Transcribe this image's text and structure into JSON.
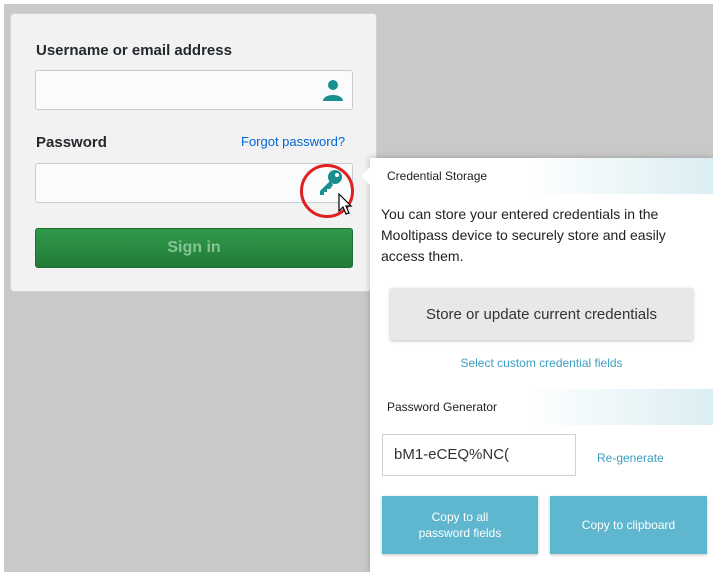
{
  "login": {
    "username_label": "Username or email address",
    "password_label": "Password",
    "forgot_link": "Forgot password?",
    "username_value": "",
    "password_value": "",
    "signin_label": "Sign in",
    "user_icon": "user-icon",
    "key_icon": "key-icon"
  },
  "popup": {
    "credential_storage_title": "Credential Storage",
    "description": "You can store your entered credentials in the Mooltipass device to securely store and easily access them.",
    "store_button": "Store or update current credentials",
    "custom_fields_link": "Select custom credential fields",
    "password_generator_title": "Password Generator",
    "generated_password": "bM1-eCEQ%NC(",
    "regenerate_link": "Re-generate",
    "copy_all_line1": "Copy to all",
    "copy_all_line2": "password fields",
    "copy_clipboard": "Copy to clipboard"
  },
  "colors": {
    "accent": "#3c9fc2",
    "icon_teal": "#1b8f8f",
    "signin_green": "#2f9a4a",
    "copy_button": "#5fb6cf",
    "highlight_ring": "#e02020"
  }
}
